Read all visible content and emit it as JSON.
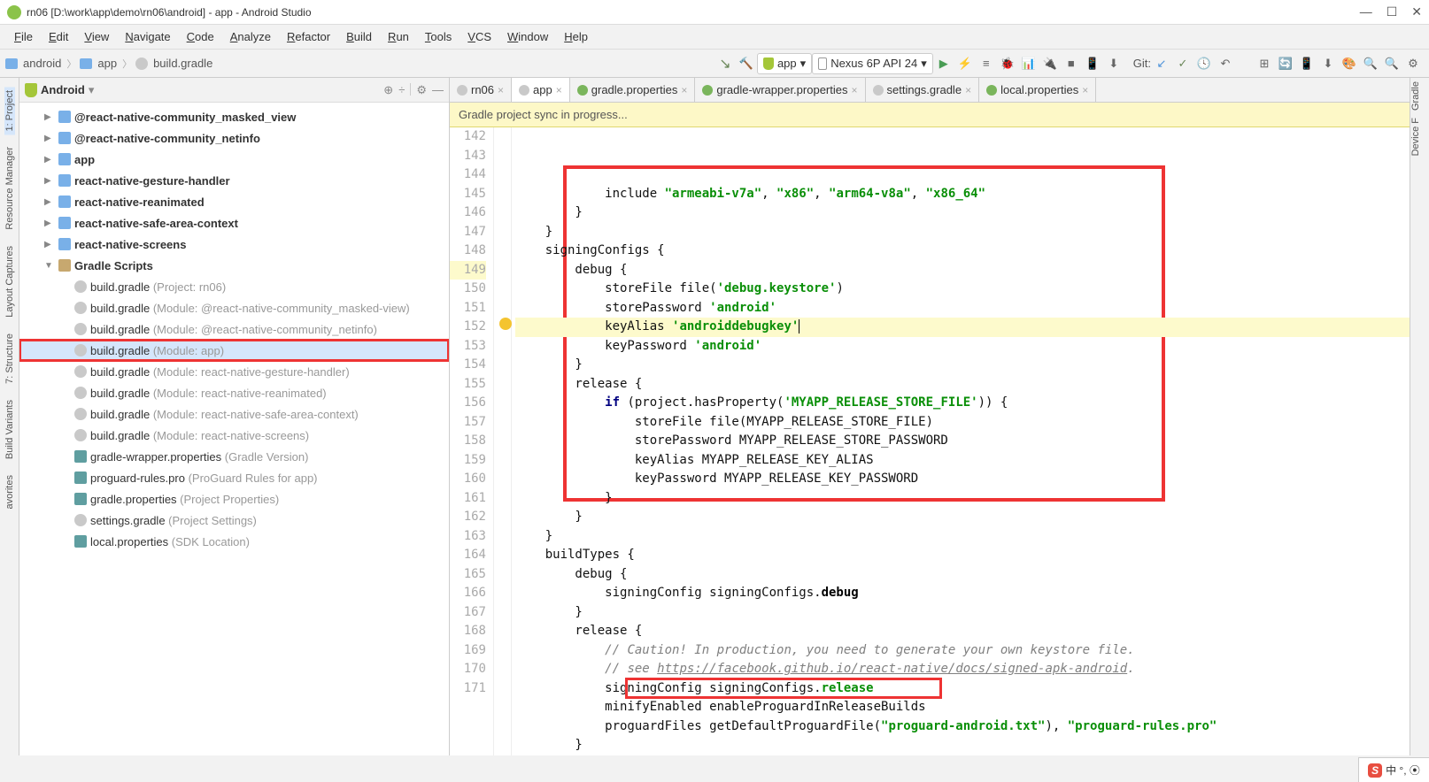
{
  "window": {
    "title": "rn06 [D:\\work\\app\\demo\\rn06\\android] - app - Android Studio"
  },
  "menu": [
    "File",
    "Edit",
    "View",
    "Navigate",
    "Code",
    "Analyze",
    "Refactor",
    "Build",
    "Run",
    "Tools",
    "VCS",
    "Window",
    "Help"
  ],
  "breadcrumb": {
    "android": "android",
    "app": "app",
    "file": "build.gradle"
  },
  "toolbar": {
    "run_target": "app",
    "device": "Nexus 6P API 24",
    "git": "Git:"
  },
  "left_tools": [
    "1: Project",
    "Resource Manager",
    "Layout Captures",
    "7: Structure",
    "Build Variants",
    "avorites"
  ],
  "right_tools": [
    "Gradle",
    "Device F"
  ],
  "panel": {
    "title": "Android"
  },
  "tree": [
    {
      "d": 1,
      "exp": "▶",
      "icon": "mod",
      "label": "@react-native-community_masked_view",
      "bold": true
    },
    {
      "d": 1,
      "exp": "▶",
      "icon": "mod",
      "label": "@react-native-community_netinfo",
      "bold": true
    },
    {
      "d": 1,
      "exp": "▶",
      "icon": "mod",
      "label": "app",
      "bold": true
    },
    {
      "d": 1,
      "exp": "▶",
      "icon": "mod",
      "label": "react-native-gesture-handler",
      "bold": true
    },
    {
      "d": 1,
      "exp": "▶",
      "icon": "mod",
      "label": "react-native-reanimated",
      "bold": true
    },
    {
      "d": 1,
      "exp": "▶",
      "icon": "mod",
      "label": "react-native-safe-area-context",
      "bold": true
    },
    {
      "d": 1,
      "exp": "▶",
      "icon": "mod",
      "label": "react-native-screens",
      "bold": true
    },
    {
      "d": 1,
      "exp": "▼",
      "icon": "fold",
      "label": "Gradle Scripts",
      "bold": true
    },
    {
      "d": 2,
      "exp": "",
      "icon": "gradle",
      "label": "build.gradle",
      "desc": "(Project: rn06)"
    },
    {
      "d": 2,
      "exp": "",
      "icon": "gradle",
      "label": "build.gradle",
      "desc": "(Module: @react-native-community_masked-view)"
    },
    {
      "d": 2,
      "exp": "",
      "icon": "gradle",
      "label": "build.gradle",
      "desc": "(Module: @react-native-community_netinfo)"
    },
    {
      "d": 2,
      "exp": "",
      "icon": "gradle",
      "label": "build.gradle",
      "desc": "(Module: app)",
      "sel": true,
      "hl": true
    },
    {
      "d": 2,
      "exp": "",
      "icon": "gradle",
      "label": "build.gradle",
      "desc": "(Module: react-native-gesture-handler)"
    },
    {
      "d": 2,
      "exp": "",
      "icon": "gradle",
      "label": "build.gradle",
      "desc": "(Module: react-native-reanimated)"
    },
    {
      "d": 2,
      "exp": "",
      "icon": "gradle",
      "label": "build.gradle",
      "desc": "(Module: react-native-safe-area-context)"
    },
    {
      "d": 2,
      "exp": "",
      "icon": "gradle",
      "label": "build.gradle",
      "desc": "(Module: react-native-screens)"
    },
    {
      "d": 2,
      "exp": "",
      "icon": "props",
      "label": "gradle-wrapper.properties",
      "desc": "(Gradle Version)"
    },
    {
      "d": 2,
      "exp": "",
      "icon": "props",
      "label": "proguard-rules.pro",
      "desc": "(ProGuard Rules for app)"
    },
    {
      "d": 2,
      "exp": "",
      "icon": "props",
      "label": "gradle.properties",
      "desc": "(Project Properties)"
    },
    {
      "d": 2,
      "exp": "",
      "icon": "gradle",
      "label": "settings.gradle",
      "desc": "(Project Settings)"
    },
    {
      "d": 2,
      "exp": "",
      "icon": "props",
      "label": "local.properties",
      "desc": "(SDK Location)"
    }
  ],
  "tabs": [
    {
      "label": "rn06",
      "icon": "gradle"
    },
    {
      "label": "app",
      "icon": "gradle",
      "active": true
    },
    {
      "label": "gradle.properties",
      "icon": "props"
    },
    {
      "label": "gradle-wrapper.properties",
      "icon": "props"
    },
    {
      "label": "settings.gradle",
      "icon": "gradle"
    },
    {
      "label": "local.properties",
      "icon": "props"
    }
  ],
  "notif": "Gradle project sync in progress...",
  "code": {
    "start": 142,
    "lines": [
      {
        "n": 142,
        "html": "            include <span class='str'>\"armeabi-v7a\"</span>, <span class='str'>\"x86\"</span>, <span class='str'>\"arm64-v8a\"</span>, <span class='str'>\"x86_64\"</span>"
      },
      {
        "n": 143,
        "html": "        }"
      },
      {
        "n": 144,
        "html": "    }"
      },
      {
        "n": 145,
        "html": "    signingConfigs {"
      },
      {
        "n": 146,
        "html": "        debug {"
      },
      {
        "n": 147,
        "html": "            storeFile file(<span class='str'>'debug.keystore'</span>)"
      },
      {
        "n": 148,
        "html": "            storePassword <span class='str'>'android'</span>"
      },
      {
        "n": 149,
        "hl": true,
        "bulb": true,
        "html": "            keyAlias <span class='str'>'androiddebugkey'</span><span style='border-left:1px solid #000'></span>"
      },
      {
        "n": 150,
        "html": "            keyPassword <span class='str'>'android'</span>"
      },
      {
        "n": 151,
        "html": "        }"
      },
      {
        "n": 152,
        "html": "        release {"
      },
      {
        "n": 153,
        "html": "            <span class='kw'>if</span> (project.hasProperty(<span class='str'>'MYAPP_RELEASE_STORE_FILE'</span>)) {"
      },
      {
        "n": 154,
        "html": "                storeFile file(MYAPP_RELEASE_STORE_FILE)"
      },
      {
        "n": 155,
        "html": "                storePassword MYAPP_RELEASE_STORE_PASSWORD"
      },
      {
        "n": 156,
        "html": "                keyAlias MYAPP_RELEASE_KEY_ALIAS"
      },
      {
        "n": 157,
        "html": "                keyPassword MYAPP_RELEASE_KEY_PASSWORD"
      },
      {
        "n": 158,
        "html": "            }"
      },
      {
        "n": 159,
        "html": "        }"
      },
      {
        "n": 160,
        "html": "    }"
      },
      {
        "n": 161,
        "html": "    buildTypes {"
      },
      {
        "n": 162,
        "html": "        debug {"
      },
      {
        "n": 163,
        "html": "            signingConfig signingConfigs.<span class='bold-debug'>debug</span>"
      },
      {
        "n": 164,
        "html": "        }"
      },
      {
        "n": 165,
        "html": "        release {"
      },
      {
        "n": 166,
        "html": "            <span class='comment'>// Caution! In production, you need to generate your own keystore file.</span>"
      },
      {
        "n": 167,
        "html": "            <span class='comment'>// see <span class='comment-link'>https://facebook.github.io/react-native/docs/signed-apk-android</span>.</span>"
      },
      {
        "n": 168,
        "box": true,
        "html": "            signingConfig signingConfigs.<span class='green-bold'>release</span>"
      },
      {
        "n": 169,
        "html": "            minifyEnabled enableProguardInReleaseBuilds"
      },
      {
        "n": 170,
        "html": "            proguardFiles getDefaultProguardFile(<span class='str'>\"proguard-android.txt\"</span>), <span class='str'>\"proguard-rules.pro\"</span>"
      },
      {
        "n": 171,
        "html": "        }"
      }
    ]
  },
  "corner": {
    "s": "S",
    "text": "中 °, ⦿"
  }
}
